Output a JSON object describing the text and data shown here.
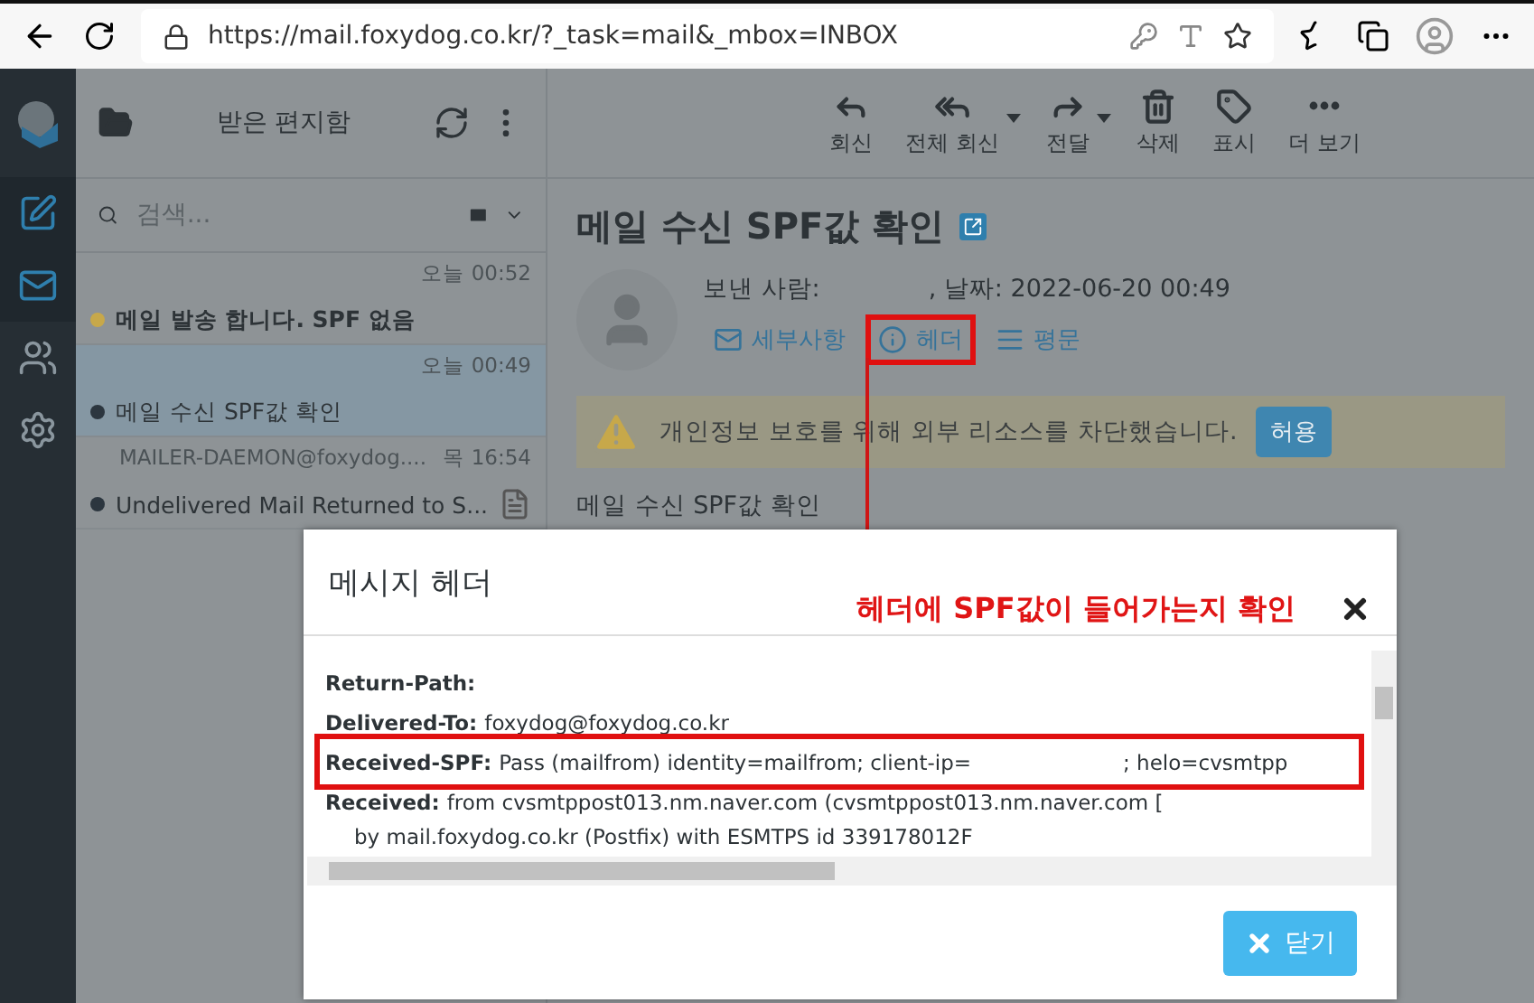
{
  "browser": {
    "url": "https://mail.foxydog.co.kr/?_task=mail&_mbox=INBOX"
  },
  "list_header": {
    "folder": "받은 편지함",
    "search": {
      "placeholder": "검색..."
    }
  },
  "messages": [
    {
      "time": "오늘 00:52",
      "subject": "메일 발송 합니다. SPF 없음",
      "unread": true,
      "selected": false,
      "color": "#c7a84a",
      "attachment": false
    },
    {
      "time": "오늘 00:49",
      "subject": "메일 수신 SPF값 확인",
      "unread": false,
      "selected": true,
      "color": "#2c363f",
      "attachment": false
    },
    {
      "sender": "MAILER-DAEMON@foxydog....",
      "time": "목 16:54",
      "subject": "Undelivered Mail Returned to S...",
      "unread": false,
      "selected": false,
      "color": "#2c363f",
      "attachment": true
    }
  ],
  "toolbar": [
    {
      "kind": "reply",
      "label": "회신",
      "has_menu": false
    },
    {
      "kind": "reply-all",
      "label": "전체 회신",
      "has_menu": true
    },
    {
      "kind": "forward",
      "label": "전달",
      "has_menu": true
    },
    {
      "kind": "delete",
      "label": "삭제",
      "has_menu": false
    },
    {
      "kind": "tag",
      "label": "표시",
      "has_menu": false
    },
    {
      "kind": "more",
      "label": "더 보기",
      "has_menu": false
    }
  ],
  "message": {
    "title": "메일 수신 SPF값 확인",
    "from_label": "보낸 사람:",
    "date": ", 날짜: 2022-06-20 00:49",
    "links": [
      {
        "kind": "details",
        "label": "세부사항",
        "highlighted": false
      },
      {
        "kind": "headers",
        "label": "헤더",
        "highlighted": true
      },
      {
        "kind": "plain",
        "label": "평문",
        "highlighted": false
      }
    ],
    "notice": "개인정보 보호를 위해 외부 리소스를 차단했습니다.",
    "allow_button": "허용",
    "body": "메일 수신 SPF값 확인"
  },
  "modal": {
    "title": "메시지 헤더",
    "annotation": "헤더에 SPF값이 들어가는지 확인",
    "headers": [
      {
        "name": "Return-Path:",
        "highlighted": false
      },
      {
        "name": "Delivered-To:",
        "values": [
          "foxydog@foxydog.co.kr"
        ],
        "highlighted": false
      },
      {
        "name": "Received-SPF:",
        "values": [
          "Pass (mailfrom) identity=mailfrom; client-ip=",
          "; helo=cvsmtpp"
        ],
        "highlighted": true
      },
      {
        "name": "Received:",
        "values": [
          "from cvsmtppost013.nm.naver.com (cvsmtppost013.nm.naver.com ["
        ],
        "highlighted": false,
        "continuation": "by mail.foxydog.co.kr (Postfix) with ESMTPS id 339178012F"
      }
    ],
    "close_button": "닫기"
  }
}
